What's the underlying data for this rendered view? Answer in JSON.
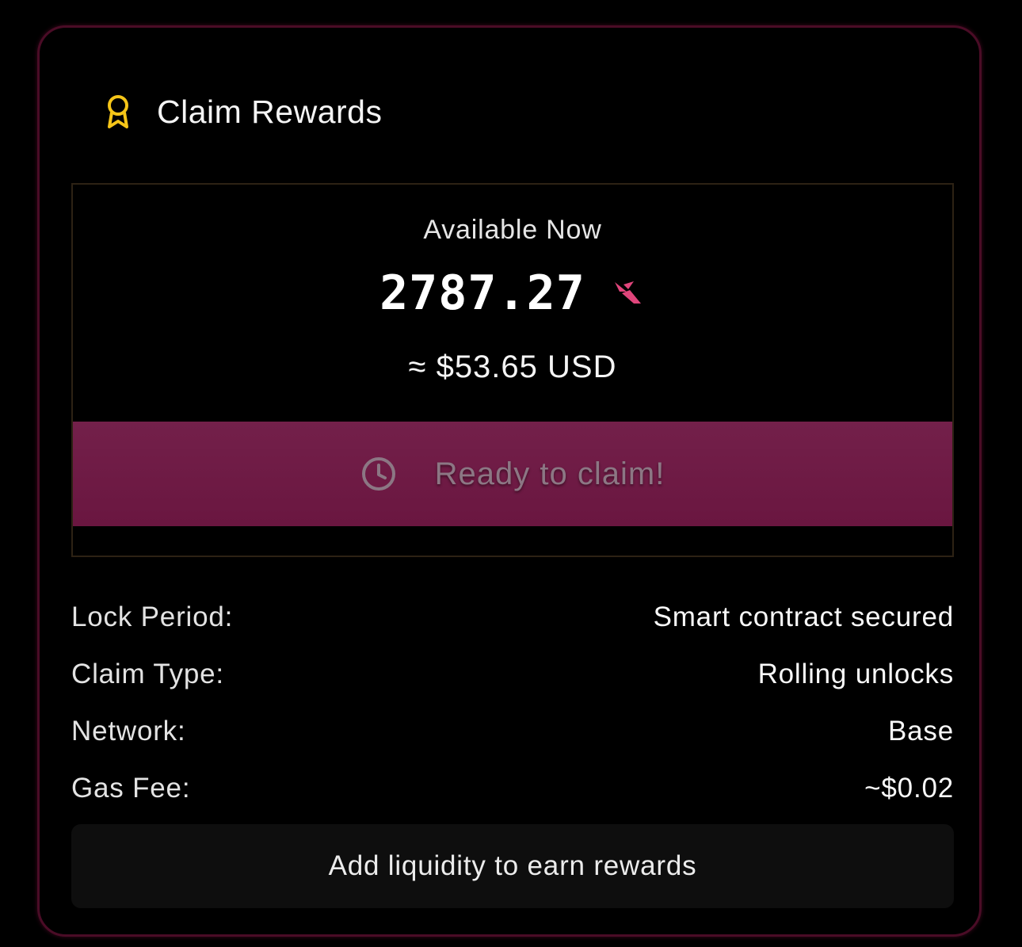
{
  "header": {
    "title": "Claim Rewards",
    "icon": "award-ribbon-icon",
    "icon_color": "#f5c518"
  },
  "balance": {
    "label": "Available Now",
    "amount": "2787.27",
    "token_icon": "token-logo-icon",
    "token_color": "#e0457b",
    "usd_value": "≈ $53.65 USD"
  },
  "claim_button": {
    "label": "Ready to claim!",
    "icon": "clock-icon",
    "background": "#711d46"
  },
  "details": [
    {
      "key": "Lock Period:",
      "value": "Smart contract secured"
    },
    {
      "key": "Claim Type:",
      "value": "Rolling unlocks"
    },
    {
      "key": "Network:",
      "value": "Base"
    },
    {
      "key": "Gas Fee:",
      "value": "~$0.02"
    }
  ],
  "cta": {
    "label": "Add liquidity to earn rewards"
  },
  "colors": {
    "card_border": "#4a0c26",
    "panel_border": "#2d2214",
    "background": "#000000"
  }
}
